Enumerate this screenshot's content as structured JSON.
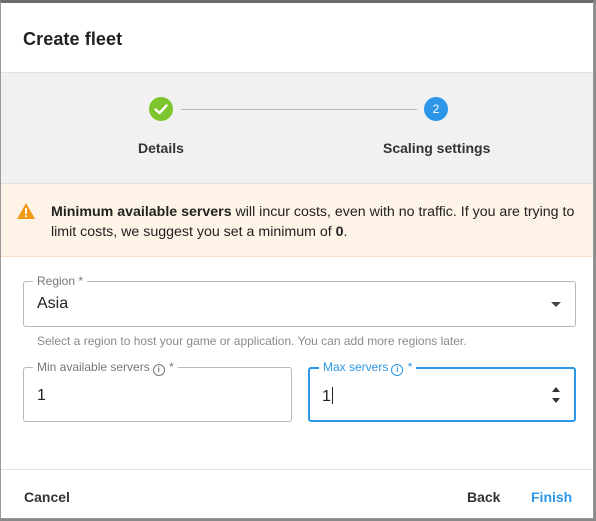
{
  "dialog": {
    "title": "Create fleet"
  },
  "stepper": {
    "steps": [
      {
        "label": "Details",
        "state": "complete"
      },
      {
        "label": "Scaling settings",
        "number": "2",
        "state": "active"
      }
    ],
    "colors": {
      "complete": "#7dc52d",
      "active": "#2c97e8"
    }
  },
  "warning": {
    "bold": "Minimum available servers",
    "text1": " will incur costs, even with no traffic. If you are trying to limit costs, we suggest you set a minimum of ",
    "value": "0",
    "text2": ".",
    "icon": "warning-triangle-icon"
  },
  "region": {
    "label": "Region *",
    "value": "Asia",
    "helper": "Select a region to host your game or application. You can add more regions later."
  },
  "min_servers": {
    "label": "Min available servers",
    "required": "*",
    "value": "1"
  },
  "max_servers": {
    "label": "Max servers",
    "required": "*",
    "value": "1"
  },
  "footer": {
    "cancel": "Cancel",
    "back": "Back",
    "finish": "Finish"
  }
}
